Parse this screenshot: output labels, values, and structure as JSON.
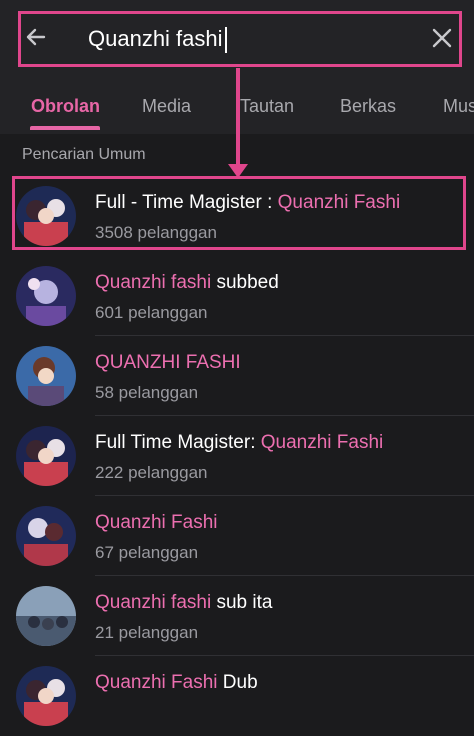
{
  "search": {
    "query": "Quanzhi fashi"
  },
  "tabs": [
    "Obrolan",
    "Media",
    "Tautan",
    "Berkas",
    "Mus"
  ],
  "section_title": "Pencarian Umum",
  "results": [
    {
      "title_plain": "Full - Time Magister : ",
      "title_hl": "Quanzhi Fashi",
      "title_after": "",
      "subscribers": "3508 pelanggan"
    },
    {
      "title_plain": "",
      "title_hl": "Quanzhi fashi",
      "title_after": " subbed",
      "subscribers": "601 pelanggan"
    },
    {
      "title_plain": "",
      "title_hl": "QUANZHI FASHI",
      "title_after": "",
      "subscribers": "58 pelanggan"
    },
    {
      "title_plain": "Full Time Magister: ",
      "title_hl": "Quanzhi Fashi",
      "title_after": "",
      "subscribers": "222 pelanggan"
    },
    {
      "title_plain": "",
      "title_hl": "Quanzhi Fashi",
      "title_after": "",
      "subscribers": "67 pelanggan"
    },
    {
      "title_plain": "",
      "title_hl": "Quanzhi fashi",
      "title_after": " sub ita",
      "subscribers": "21 pelanggan"
    },
    {
      "title_plain": "",
      "title_hl": "Quanzhi Fashi",
      "title_after": " Dub",
      "subscribers": ""
    }
  ],
  "colors": {
    "accent": "#e766a6",
    "annotation": "#e0468c",
    "background": "#1b1b1d"
  },
  "icons": {
    "back": "arrow-left-icon",
    "clear": "close-icon"
  }
}
